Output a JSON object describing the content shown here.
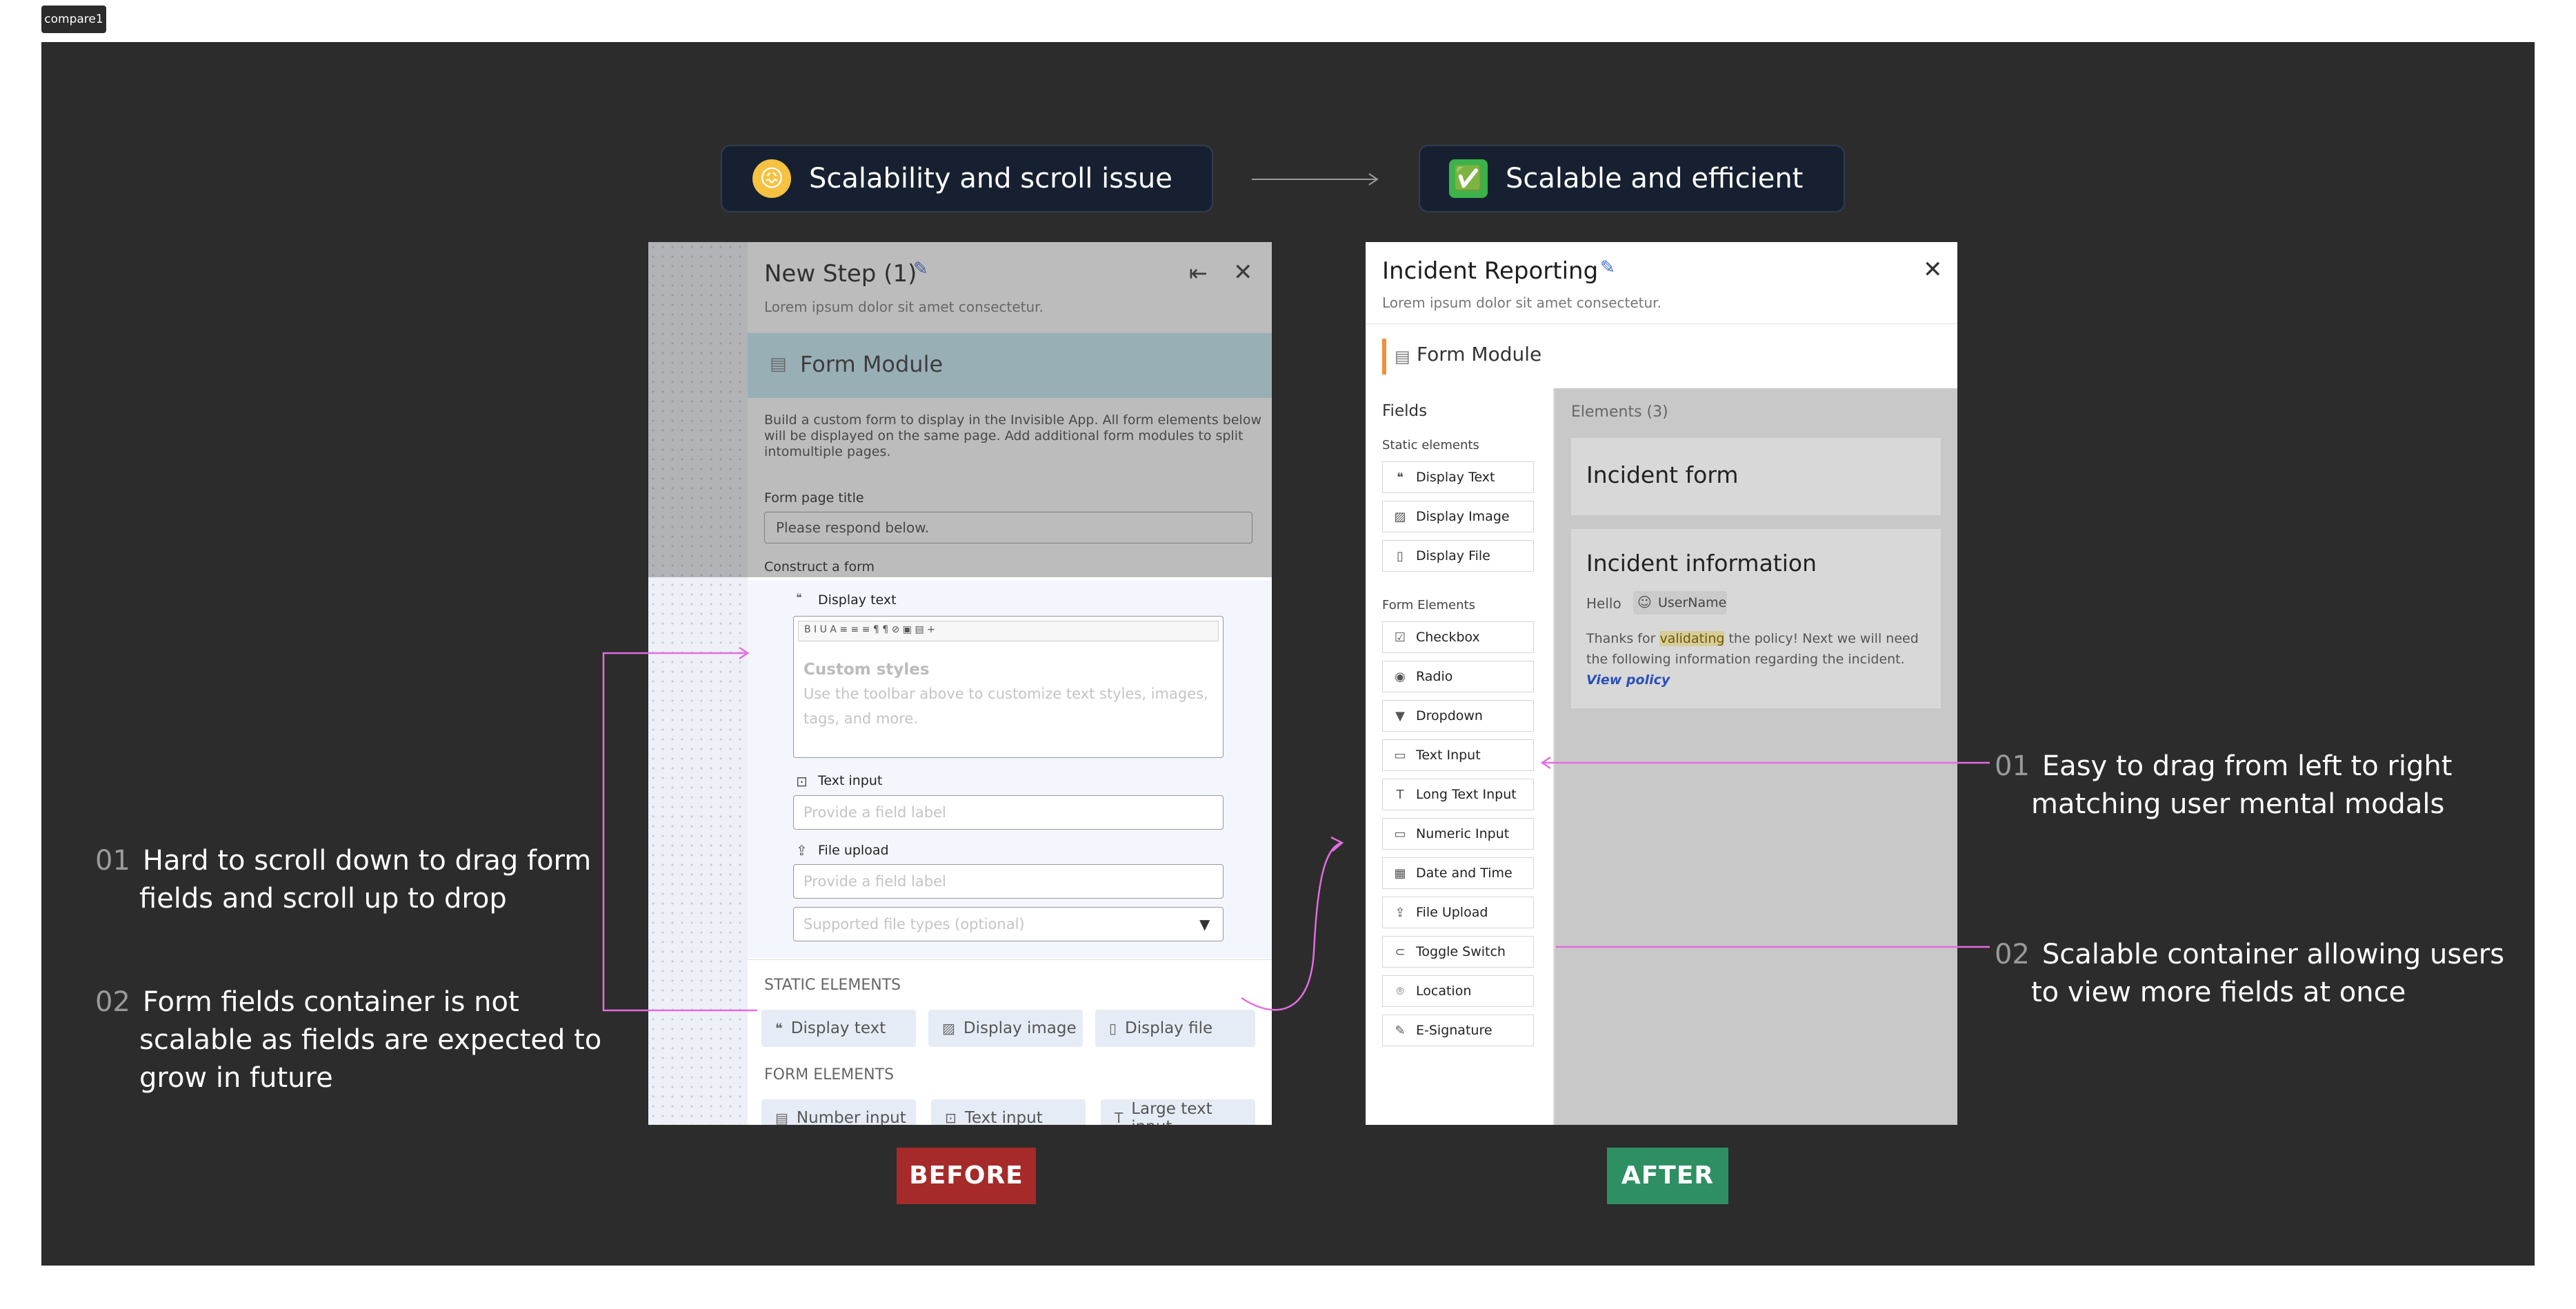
{
  "frame_label": "compare1",
  "pills": {
    "before": {
      "emoji": "😖",
      "text": "Scalability and scroll issue"
    },
    "after": {
      "emoji": "✅",
      "text": "Scalable and efficient"
    }
  },
  "badges": {
    "before": "BEFORE",
    "after": "AFTER"
  },
  "colors": {
    "before_badge": "#a62a2a",
    "after_badge": "#2e8f63",
    "annotation_line": "#e26de0",
    "canvas": "#2c2c2c"
  },
  "annotations_left": [
    {
      "num": "01",
      "line1": "Hard to scroll down to drag form",
      "line2": "fields and scroll up to drop",
      "line3": ""
    },
    {
      "num": "02",
      "line1": "Form fields container is not",
      "line2": "scalable as fields are expected to",
      "line3": "grow in future"
    }
  ],
  "annotations_right": [
    {
      "num": "01",
      "line1": "Easy to drag from left to right",
      "line2": "matching user mental modals"
    },
    {
      "num": "02",
      "line1": "Scalable container allowing users",
      "line2": "to view more fields at once"
    }
  ],
  "before": {
    "title": "New Step (1)",
    "subtitle": "Lorem ipsum dolor sit amet consectetur.",
    "module": "Form Module",
    "desc1": "Build a custom form to display in the Invisible App. All form elements below",
    "desc2": "will be displayed on the same page. Add additional form modules to split",
    "desc3": "intomultiple pages.",
    "page_title_label": "Form page title",
    "page_title_value": "Please respond below.",
    "construct_label": "Construct a form",
    "display_text_label": "Display text",
    "toolbar": "B  I  U  A  ≡  ≡  ≡  ¶  ¶  ⊘  ▣  ▤  +",
    "custom_styles": "Custom styles",
    "custom_desc1": "Use the toolbar above to customize text styles, images,",
    "custom_desc2": "tags, and more.",
    "text_input_label": "Text input",
    "text_input_placeholder": "Provide a field label",
    "file_upload_label": "File upload",
    "file_upload_placeholder": "Provide a field label",
    "file_types_placeholder": "Supported file types (optional)",
    "static_heading": "STATIC ELEMENTS",
    "static_chips": [
      "Display text",
      "Display image",
      "Display file"
    ],
    "form_heading": "FORM ELEMENTS",
    "form_chips": [
      "Number input",
      "Text input",
      "Large text input"
    ]
  },
  "after": {
    "title": "Incident Reporting",
    "subtitle": "Lorem ipsum dolor sit amet consectetur.",
    "module": "Form Module",
    "fields_heading": "Fields",
    "static_label": "Static elements",
    "static_items": [
      {
        "icon": "quote-icon",
        "glyph": "❝",
        "label": "Display Text"
      },
      {
        "icon": "image-icon",
        "glyph": "▨",
        "label": "Display Image"
      },
      {
        "icon": "file-icon",
        "glyph": "▯",
        "label": "Display File"
      }
    ],
    "form_label": "Form Elements",
    "form_items": [
      {
        "icon": "checkbox-icon",
        "glyph": "☑",
        "label": "Checkbox"
      },
      {
        "icon": "radio-icon",
        "glyph": "◉",
        "label": "Radio"
      },
      {
        "icon": "dropdown-icon",
        "glyph": "▼",
        "label": "Dropdown"
      },
      {
        "icon": "text-input-icon",
        "glyph": "▭",
        "label": "Text Input"
      },
      {
        "icon": "long-text-icon",
        "glyph": "T",
        "label": "Long Text Input"
      },
      {
        "icon": "numeric-icon",
        "glyph": "▭",
        "label": "Numeric Input"
      },
      {
        "icon": "calendar-icon",
        "glyph": "▦",
        "label": "Date and Time"
      },
      {
        "icon": "upload-icon",
        "glyph": "⇪",
        "label": "File Upload"
      },
      {
        "icon": "toggle-icon",
        "glyph": "⊂",
        "label": "Toggle Switch"
      },
      {
        "icon": "location-icon",
        "glyph": "⌾",
        "label": "Location"
      },
      {
        "icon": "signature-icon",
        "glyph": "✎",
        "label": "E-Signature"
      }
    ],
    "elements_heading": "Elements (3)",
    "card1_title": "Incident form",
    "card2_title": "Incident information",
    "hello": "Hello",
    "username": "UserName",
    "thanks_pre": "Thanks for ",
    "thanks_highlight": "validating",
    "thanks_post": " the policy! Next we will need",
    "thanks_line2": "the following information regarding the incident.",
    "view_policy": "View policy"
  }
}
